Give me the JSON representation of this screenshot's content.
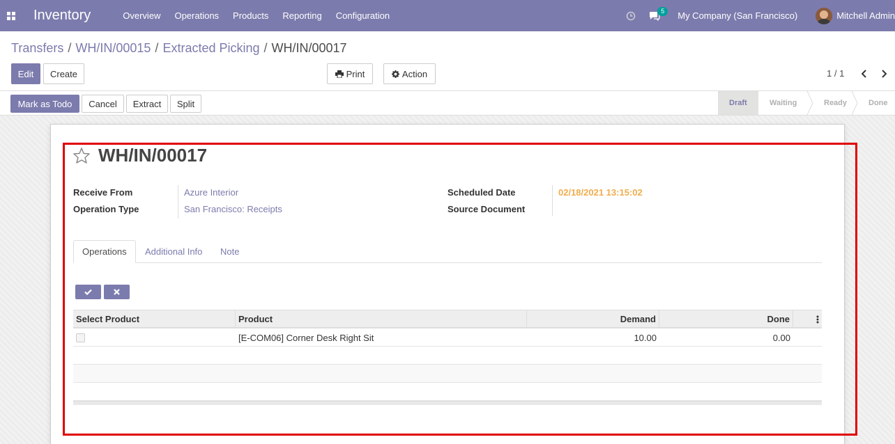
{
  "navbar": {
    "app_name": "Inventory",
    "menu": [
      "Overview",
      "Operations",
      "Products",
      "Reporting",
      "Configuration"
    ],
    "chat_count": "5",
    "company": "My Company (San Francisco)",
    "user": "Mitchell Admin",
    "bg_color": "#7c7bad"
  },
  "breadcrumb": {
    "items": [
      "Transfers",
      "WH/IN/00015",
      "Extracted Picking"
    ],
    "current": "WH/IN/00017"
  },
  "buttons": {
    "edit": "Edit",
    "create": "Create",
    "print": "Print",
    "action": "Action"
  },
  "pager": {
    "text": "1 / 1"
  },
  "statusbar": {
    "mark_todo": "Mark as Todo",
    "cancel": "Cancel",
    "extract": "Extract",
    "split": "Split",
    "stages": [
      "Draft",
      "Waiting",
      "Ready",
      "Done"
    ],
    "active_stage": "Draft"
  },
  "record": {
    "name": "WH/IN/00017",
    "fields": {
      "receive_from_label": "Receive From",
      "receive_from": "Azure Interior",
      "operation_type_label": "Operation Type",
      "operation_type": "San Francisco: Receipts",
      "scheduled_date_label": "Scheduled Date",
      "scheduled_date": "02/18/2021 13:15:02",
      "source_document_label": "Source Document",
      "source_document": ""
    }
  },
  "tabs": [
    "Operations",
    "Additional Info",
    "Note"
  ],
  "table": {
    "headers": [
      "Select Product",
      "Product",
      "Demand",
      "Done"
    ],
    "rows": [
      {
        "product": "[E-COM06] Corner Desk Right Sit",
        "demand": "10.00",
        "done": "0.00"
      }
    ]
  },
  "colors": {
    "accent": "#7c7bad",
    "date_warning": "#f0ad4e",
    "highlight": "#e00000"
  }
}
